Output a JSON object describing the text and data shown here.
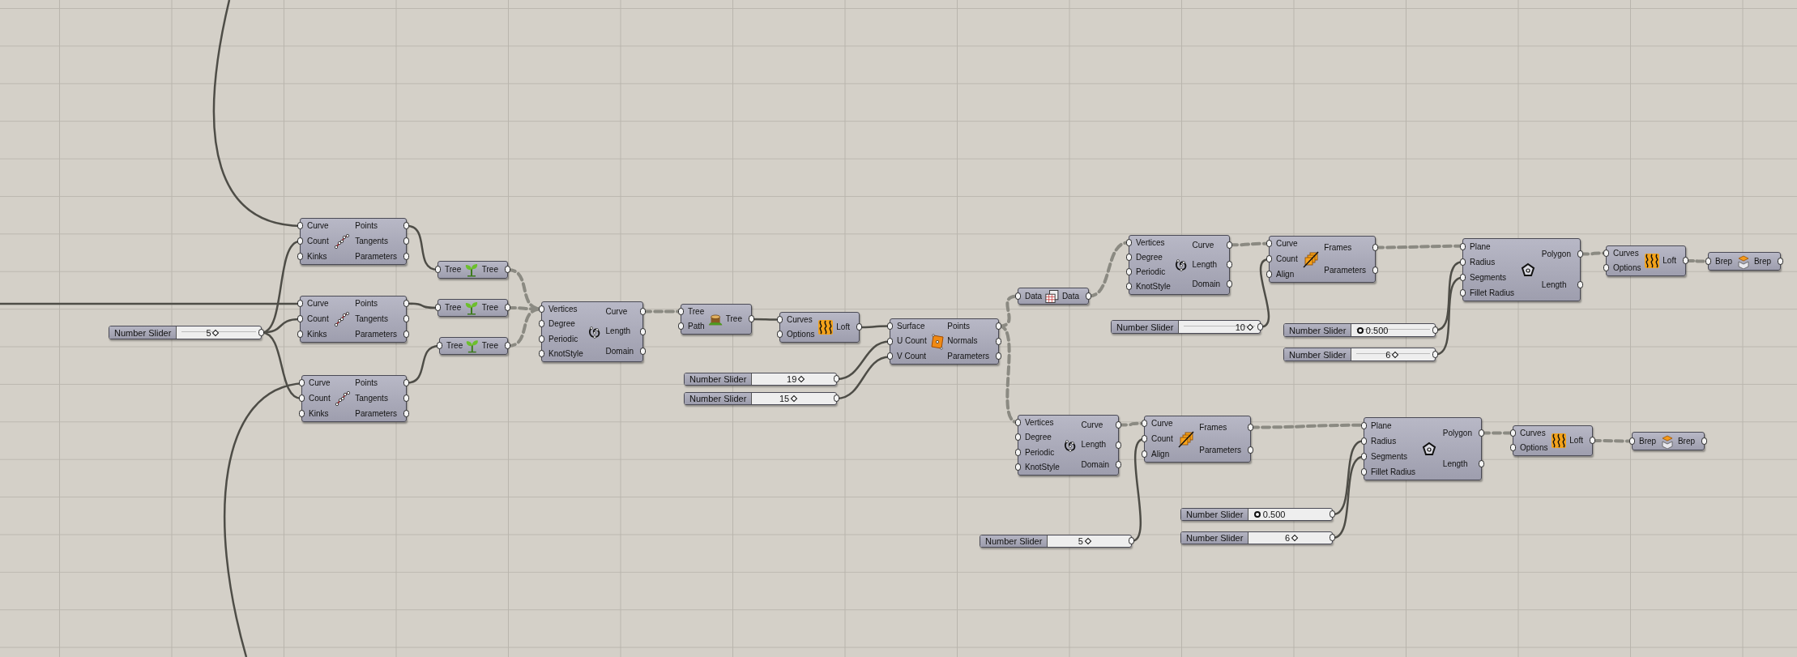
{
  "canvas": {
    "nodes": [
      {
        "kind": "component",
        "inputs": [
          "Curve",
          "Count",
          "Kinks"
        ],
        "outputs": [
          "Points",
          "Tangents",
          "Parameters"
        ]
      },
      {
        "kind": "component",
        "inputs": [
          "Curve",
          "Count",
          "Kinks"
        ],
        "outputs": [
          "Points",
          "Tangents",
          "Parameters"
        ]
      },
      {
        "kind": "component",
        "inputs": [
          "Curve",
          "Count",
          "Kinks"
        ],
        "outputs": [
          "Points",
          "Tangents",
          "Parameters"
        ]
      },
      {
        "kind": "slider",
        "label": "Number Slider",
        "value": "5",
        "level": 0.46
      },
      {
        "kind": "component",
        "inputs": [
          "Tree"
        ],
        "outputs": [
          "Tree"
        ]
      },
      {
        "kind": "component",
        "inputs": [
          "Tree"
        ],
        "outputs": [
          "Tree"
        ]
      },
      {
        "kind": "component",
        "inputs": [
          "Tree"
        ],
        "outputs": [
          "Tree"
        ]
      },
      {
        "kind": "component",
        "inputs": [
          "Vertices",
          "Degree",
          "Periodic",
          "KnotStyle"
        ],
        "outputs": [
          "Curve",
          "Length",
          "Domain"
        ]
      },
      {
        "kind": "component",
        "inputs": [
          "Tree",
          "Path"
        ],
        "outputs": [
          "Tree"
        ]
      },
      {
        "kind": "component",
        "inputs": [
          "Curves",
          "Options"
        ],
        "outputs": [
          "Loft"
        ]
      },
      {
        "kind": "component",
        "inputs": [
          "Surface",
          "U Count",
          "V Count"
        ],
        "outputs": [
          "Points",
          "Normals",
          "Parameters"
        ]
      },
      {
        "kind": "slider",
        "label": "Number Slider",
        "value": "19",
        "level": 0.6
      },
      {
        "kind": "slider",
        "label": "Number Slider",
        "value": "15",
        "level": 0.5
      },
      {
        "kind": "component",
        "inputs": [
          "Data"
        ],
        "outputs": [
          "Data"
        ]
      },
      {
        "kind": "component",
        "inputs": [
          "Vertices",
          "Degree",
          "Periodic",
          "KnotStyle"
        ],
        "outputs": [
          "Curve",
          "Length",
          "Domain"
        ]
      },
      {
        "kind": "component",
        "inputs": [
          "Curve",
          "Count",
          "Align"
        ],
        "outputs": [
          "Frames",
          "Parameters"
        ]
      },
      {
        "kind": "slider",
        "label": "Number Slider",
        "value": "10",
        "level": 0.93
      },
      {
        "kind": "component",
        "inputs": [
          "Plane",
          "Radius",
          "Segments",
          "Fillet Radius"
        ],
        "outputs": [
          "Polygon",
          "Length"
        ]
      },
      {
        "kind": "slider",
        "label": "Number Slider",
        "value": "0.500",
        "level": 0.05
      },
      {
        "kind": "slider",
        "label": "Number Slider",
        "value": "6",
        "level": 0.53
      },
      {
        "kind": "component",
        "inputs": [
          "Curves",
          "Options"
        ],
        "outputs": [
          "Loft"
        ]
      },
      {
        "kind": "component",
        "inputs": [
          "Brep"
        ],
        "outputs": [
          "Brep"
        ]
      },
      {
        "kind": "component",
        "inputs": [
          "Vertices",
          "Degree",
          "Periodic",
          "KnotStyle"
        ],
        "outputs": [
          "Curve",
          "Length",
          "Domain"
        ]
      },
      {
        "kind": "component",
        "inputs": [
          "Curve",
          "Count",
          "Align"
        ],
        "outputs": [
          "Frames",
          "Parameters"
        ]
      },
      {
        "kind": "slider",
        "label": "Number Slider",
        "value": "5",
        "level": 0.48
      },
      {
        "kind": "component",
        "inputs": [
          "Plane",
          "Radius",
          "Segments",
          "Fillet Radius"
        ],
        "outputs": [
          "Polygon",
          "Length"
        ]
      },
      {
        "kind": "slider",
        "label": "Number Slider",
        "value": "0.500",
        "level": 0.05
      },
      {
        "kind": "slider",
        "label": "Number Slider",
        "value": "6",
        "level": 0.56
      },
      {
        "kind": "component",
        "inputs": [
          "Curves",
          "Options"
        ],
        "outputs": [
          "Loft"
        ]
      },
      {
        "kind": "component",
        "inputs": [
          "Brep"
        ],
        "outputs": [
          "Brep"
        ]
      }
    ]
  }
}
